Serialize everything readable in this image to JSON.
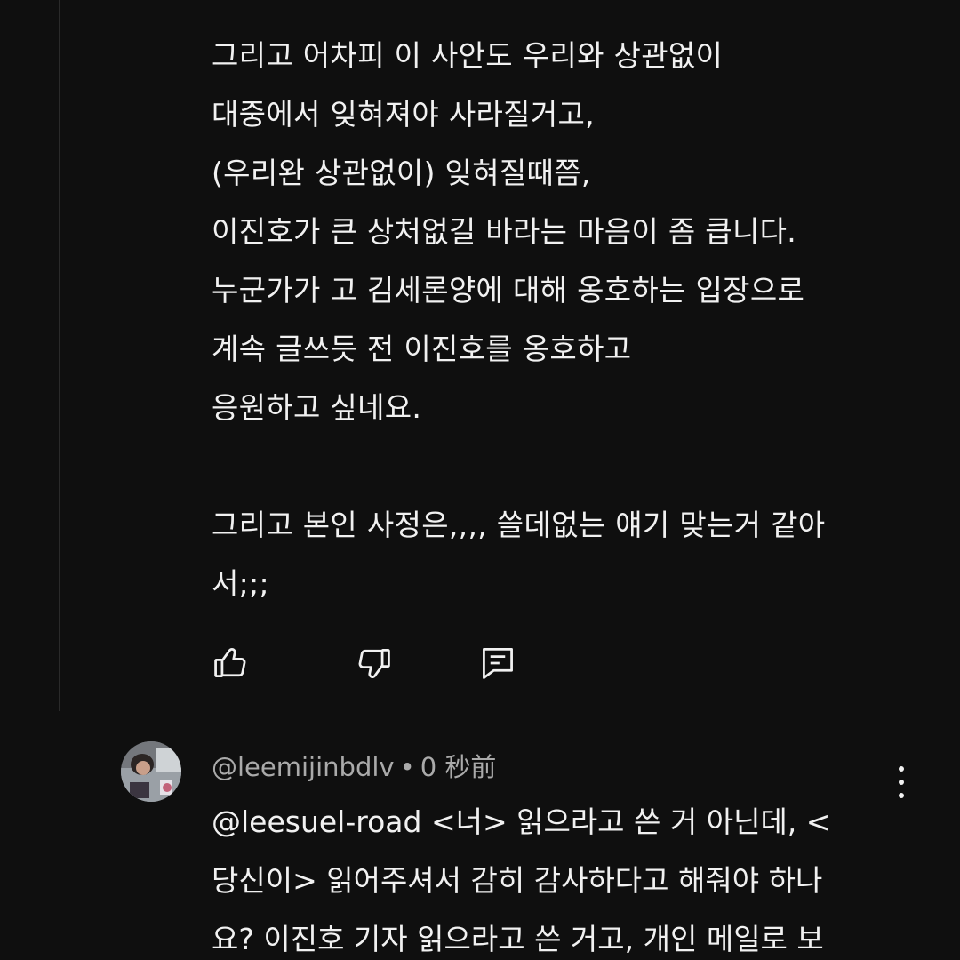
{
  "comment": {
    "lines": [
      "그리고 어차피 이 사안도 우리와 상관없이",
      "대중에서 잊혀져야 사라질거고,",
      "(우리완 상관없이) 잊혀질때쯤,",
      "이진호가 큰 상처없길 바라는 마음이 좀 큽니다.",
      "누군가가 고 김세론양에 대해 옹호하는 입장으로",
      "계속 글쓰듯 전 이진호를 옹호하고",
      "응원하고 싶네요.",
      "",
      "그리고 본인 사정은,,,, 쓸데없는 얘기 맞는거 같아",
      "서;;;"
    ],
    "actions": {
      "like_icon": "thumbs-up-icon",
      "dislike_icon": "thumbs-down-icon",
      "reply_icon": "reply-icon"
    }
  },
  "reply": {
    "author": "@leemijinbdlv",
    "separator": "•",
    "time": "0 秒前",
    "lines": [
      "@leesuel-road  <너> 읽으라고 쓴 거 아닌데,  <",
      "당신이> 읽어주셔서 감히 감사하다고 해줘야 하나",
      "요? 이진호 기자 읽으라고 쓴 거고, 개인 메일로 보"
    ],
    "more_icon": "more-vert-icon"
  },
  "colors": {
    "background": "#0f0f0f",
    "text": "#f1f1f1",
    "meta": "#aaaaaa"
  }
}
